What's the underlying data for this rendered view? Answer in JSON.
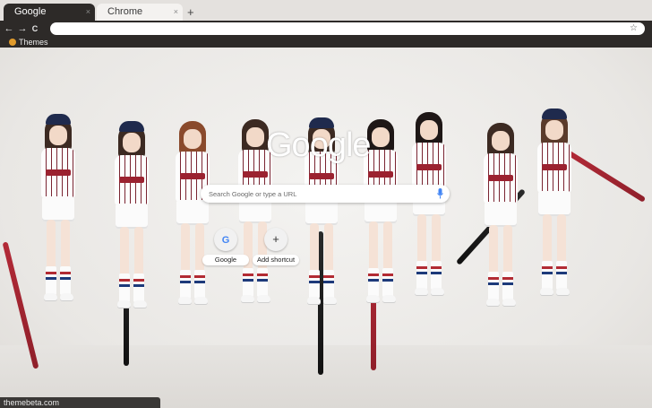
{
  "tabs": [
    {
      "label": "Google",
      "close": "×",
      "active": true
    },
    {
      "label": "Chrome",
      "close": "×",
      "active": false
    }
  ],
  "new_tab_label": "+",
  "toolbar": {
    "back": "←",
    "forward": "→",
    "reload": "C",
    "bookmark_star": "☆",
    "omnibox_value": ""
  },
  "bookmarks": [
    {
      "label": "Themes"
    }
  ],
  "ntp": {
    "logo_text": "Google",
    "search_placeholder": "Search Google or type a URL",
    "shortcuts": [
      {
        "label": "Google",
        "icon": "google-g-icon",
        "glyph": "G"
      },
      {
        "label": "Add shortcut",
        "icon": "plus-icon",
        "glyph": "+"
      }
    ]
  },
  "status_bubble": "themebeta.com",
  "colors": {
    "frame": "#2d2a28",
    "tabstrip": "#e4e1de",
    "jersey_stripe": "#7a2431",
    "cap": "#1f2a4d",
    "bat_red": "#b32a37"
  }
}
